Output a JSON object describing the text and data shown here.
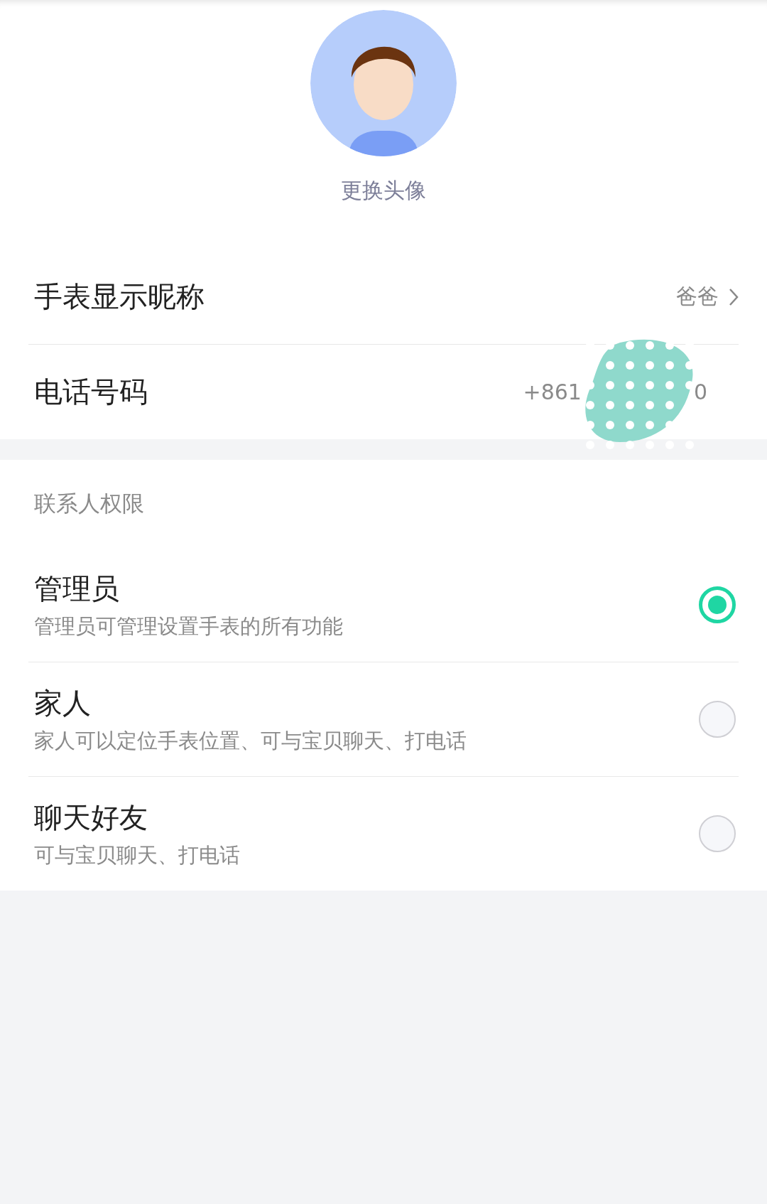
{
  "avatar": {
    "action": "更换头像"
  },
  "info_rows": [
    {
      "kind": "link",
      "label": "手表显示昵称",
      "value": "爸爸"
    },
    {
      "kind": "masked",
      "label": "电话号码",
      "value_start": "+861",
      "value_end": "0"
    }
  ],
  "permissions": {
    "title": "联系人权限",
    "options": [
      {
        "title": "管理员",
        "description": "管理员可管理设置手表的所有功能",
        "selected": true
      },
      {
        "title": "家人",
        "description": "家人可以定位手表位置、可与宝贝聊天、打电话",
        "selected": false
      },
      {
        "title": "聊天好友",
        "description": "可与宝贝聊天、打电话",
        "selected": false
      }
    ]
  }
}
